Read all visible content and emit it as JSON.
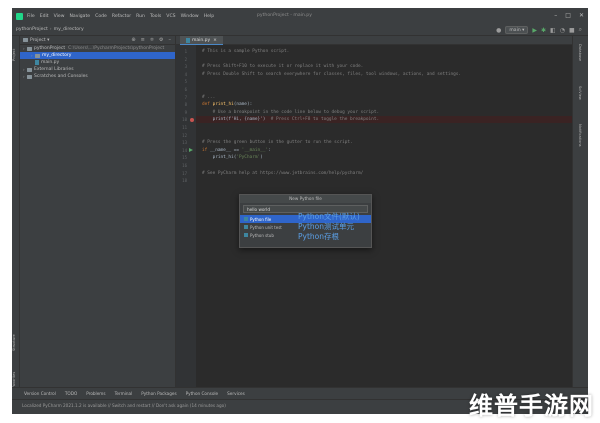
{
  "window": {
    "title": "pythonProject - main.py",
    "menus": [
      "File",
      "Edit",
      "View",
      "Navigate",
      "Code",
      "Refactor",
      "Run",
      "Tools",
      "VCS",
      "Window",
      "Help"
    ],
    "controls": [
      "–",
      "□",
      "✕"
    ]
  },
  "navbar": {
    "project": "pythonProject",
    "folder": "my_directory",
    "run_config": "main"
  },
  "project_panel": {
    "title": "Project",
    "strip_label": "Project",
    "tree": [
      {
        "label": "pythonProject",
        "extra": "C:\\Users\\...\\PycharmProjects\\pythonProject",
        "kind": "folder",
        "level": 0
      },
      {
        "label": "my_directory",
        "extra": "",
        "kind": "folder",
        "level": 1,
        "selected": true
      },
      {
        "label": "main.py",
        "extra": "",
        "kind": "file",
        "level": 1
      },
      {
        "label": "External Libraries",
        "extra": "",
        "kind": "folder",
        "level": 0
      },
      {
        "label": "Scratches and Consoles",
        "extra": "",
        "kind": "folder",
        "level": 0
      }
    ]
  },
  "editor": {
    "tab": "main.py",
    "lines": [
      {
        "n": "1",
        "segs": [
          {
            "t": "# This is a sample Python script.",
            "c": "cmt"
          }
        ]
      },
      {
        "n": "2",
        "segs": []
      },
      {
        "n": "3",
        "segs": [
          {
            "t": "# Press Shift+F10 to execute it or replace it with your code.",
            "c": "cmt"
          }
        ]
      },
      {
        "n": "4",
        "segs": [
          {
            "t": "# Press Double Shift to search everywhere for classes, files, tool windows, actions, and settings.",
            "c": "cmt"
          }
        ]
      },
      {
        "n": "5",
        "segs": []
      },
      {
        "n": "6",
        "segs": []
      },
      {
        "n": "7",
        "segs": [
          {
            "t": "# ...",
            "c": "cmt"
          }
        ]
      },
      {
        "n": "8",
        "segs": [
          {
            "t": "def ",
            "c": "kw"
          },
          {
            "t": "print_hi",
            "c": "fn"
          },
          {
            "t": "(name):",
            "c": ""
          }
        ]
      },
      {
        "n": "9",
        "segs": [
          {
            "t": "    # Use a breakpoint in the code line below to debug your script.",
            "c": "cmt"
          }
        ]
      },
      {
        "n": "10",
        "segs": [
          {
            "t": "    print(f'Hi, {name}')  ",
            "c": ""
          },
          {
            "t": "# Press Ctrl+F8 to toggle the breakpoint.",
            "c": "cmt"
          }
        ]
      },
      {
        "n": "11",
        "segs": []
      },
      {
        "n": "12",
        "segs": []
      },
      {
        "n": "13",
        "segs": [
          {
            "t": "# Press the green button in the gutter to run the script.",
            "c": "cmt"
          }
        ]
      },
      {
        "n": "14",
        "segs": [
          {
            "t": "if ",
            "c": "kw"
          },
          {
            "t": "__name__ == ",
            "c": ""
          },
          {
            "t": "'__main__'",
            "c": "str"
          },
          {
            "t": ":",
            "c": ""
          }
        ]
      },
      {
        "n": "15",
        "segs": [
          {
            "t": "    print_hi(",
            "c": ""
          },
          {
            "t": "'PyCharm'",
            "c": "str"
          },
          {
            "t": ")",
            "c": ""
          }
        ]
      },
      {
        "n": "16",
        "segs": []
      },
      {
        "n": "17",
        "segs": [
          {
            "t": "# See PyCharm help at https://www.jetbrains.com/help/pycharm/",
            "c": "cmt"
          }
        ]
      },
      {
        "n": "18",
        "segs": []
      }
    ]
  },
  "popup": {
    "title": "New Python file",
    "input_value": "hello world",
    "options": [
      "Python file",
      "Python unit test",
      "Python stub"
    ]
  },
  "annotations": [
    "Python文件(默认)",
    "Python测试单元",
    "Python存根"
  ],
  "right_strip": [
    "Database",
    "SciView",
    "Notifications"
  ],
  "left_strip_bottom": [
    "Structure",
    "Favorites"
  ],
  "bottom_tabs": [
    "Version Control",
    "TODO",
    "Problems",
    "Terminal",
    "Python Packages",
    "Python Console",
    "Services"
  ],
  "status": "Localized PyCharm 2021.1.2 is available // Switch and restart // Don't ask again (14 minutes ago)",
  "watermark": "维普手游网",
  "colors": {
    "editor_bg": "#2b2b2b",
    "panel_bg": "#3c3f41",
    "selection": "#2f65ca",
    "annotation": "#5b9fe6"
  }
}
